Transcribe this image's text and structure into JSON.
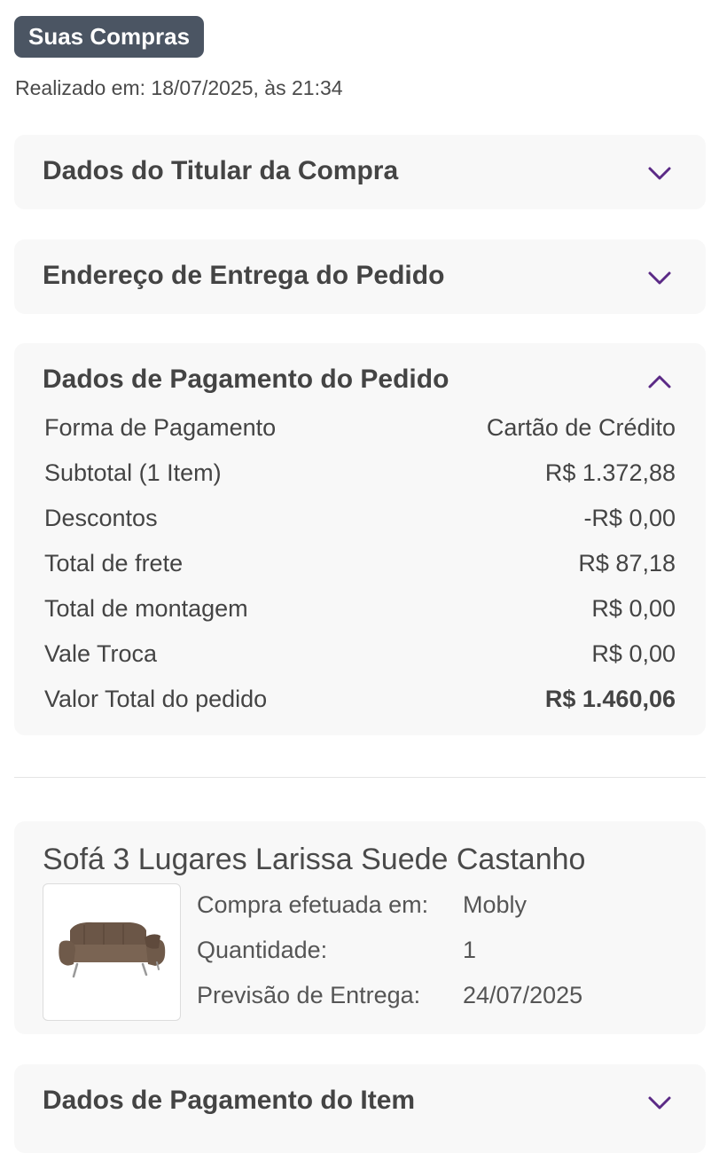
{
  "header": {
    "badge": "Suas Compras",
    "order_date": "Realizado em: 18/07/2025, às 21:34"
  },
  "sections": {
    "titular": {
      "title": "Dados do Titular da Compra",
      "expanded": false
    },
    "endereco": {
      "title": "Endereço de Entrega do Pedido",
      "expanded": false
    },
    "pagamento": {
      "title": "Dados de Pagamento do Pedido",
      "expanded": true,
      "rows": [
        {
          "label": "Forma de Pagamento",
          "value": "Cartão de Crédito"
        },
        {
          "label": "Subtotal (1 Item)",
          "value": "R$ 1.372,88"
        },
        {
          "label": "Descontos",
          "value": "-R$ 0,00"
        },
        {
          "label": "Total de frete",
          "value": "R$ 87,18"
        },
        {
          "label": "Total de montagem",
          "value": "R$ 0,00"
        },
        {
          "label": "Vale Troca",
          "value": "R$ 0,00"
        },
        {
          "label": "Valor Total do pedido",
          "value": "R$ 1.460,06"
        }
      ]
    },
    "pagamento_item": {
      "title": "Dados de Pagamento do Item",
      "expanded": false
    }
  },
  "product": {
    "name": "Sofá 3 Lugares Larissa Suede Castanho",
    "image": "sofa-thumbnail",
    "details": [
      {
        "label": "Compra efetuada em:",
        "value": "Mobly"
      },
      {
        "label": "Quantidade:",
        "value": "1"
      },
      {
        "label": "Previsão de Entrega:",
        "value": "24/07/2025"
      }
    ]
  },
  "colors": {
    "badge_bg": "#4b5563",
    "accent": "#5b2a86",
    "panel_bg": "#f8f8f8"
  },
  "icons": {
    "collapsed": "chevron-down-icon",
    "expanded": "chevron-up-icon"
  }
}
